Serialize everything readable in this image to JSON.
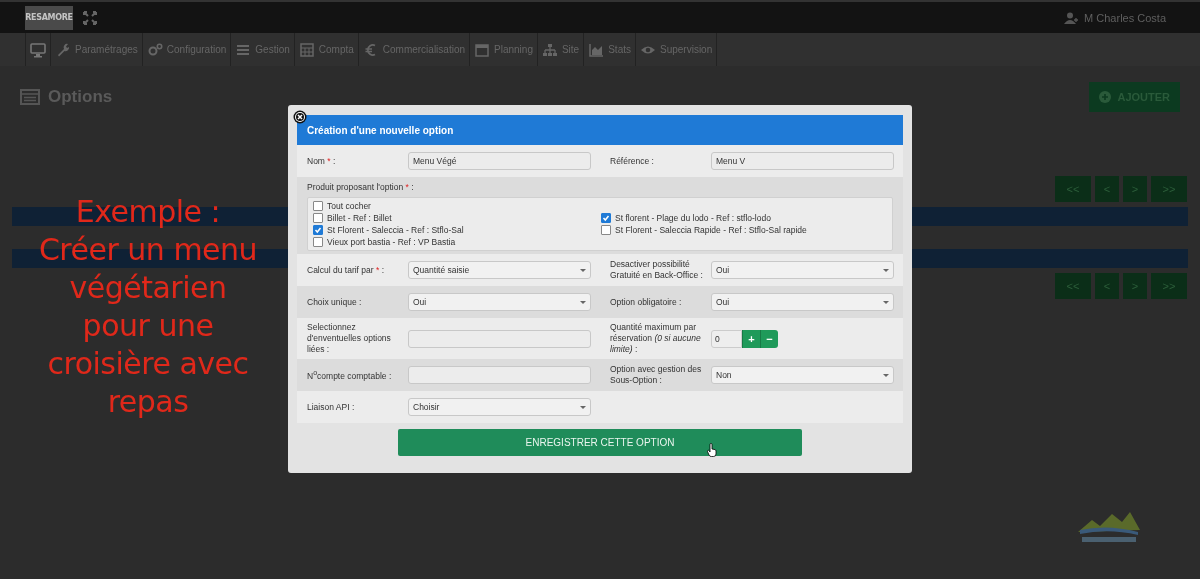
{
  "topbar": {
    "logo": "RESAMORE",
    "user": "M Charles Costa"
  },
  "nav": [
    {
      "kind": "home"
    },
    {
      "kind": "tab",
      "label": "Paramétrages"
    },
    {
      "kind": "tab",
      "label": "Configuration"
    },
    {
      "kind": "tab",
      "label": "Gestion"
    },
    {
      "kind": "tab",
      "label": "Compta"
    },
    {
      "kind": "tab",
      "label": "Commercialisation"
    },
    {
      "kind": "tab",
      "label": "Planning"
    },
    {
      "kind": "tab",
      "label": "Site"
    },
    {
      "kind": "tab",
      "label": "Stats"
    },
    {
      "kind": "tab",
      "label": "Supervision"
    }
  ],
  "page": {
    "title": "Options",
    "add_button": "AJOUTER",
    "pagers": [
      [
        "<<",
        "<",
        ">",
        ">>"
      ],
      [
        "<<",
        "<",
        ">",
        ">>"
      ]
    ]
  },
  "caption": {
    "lines": [
      "Exemple :",
      "Créer un menu",
      "végétarien",
      "pour une",
      "croisière avec",
      "repas"
    ]
  },
  "modal": {
    "title": "Création d'une nouvelle option",
    "products": {
      "label": "Produit proposant l'option ",
      "required_mark": "*",
      "label_end": " :",
      "left": [
        {
          "label": "Tout cocher",
          "checked": false
        },
        {
          "label": "Billet - Ref : Billet",
          "checked": false
        },
        {
          "label": "St Florent - Saleccia - Ref : Stflo-Sal",
          "checked": true
        },
        {
          "label": "Vieux port bastia - Ref : VP Bastia",
          "checked": false
        }
      ],
      "right": [
        {
          "label": "St florent - Plage du lodo - Ref : stflo-lodo",
          "checked": true
        },
        {
          "label": "St Florent - Saleccia Rapide - Ref : Stflo-Sal rapide",
          "checked": false
        }
      ]
    },
    "rows": [
      {
        "fields": [
          {
            "kind": "text",
            "label": "Nom ",
            "required_mark": "*",
            "label_end": " :",
            "value": "Menu Végé"
          },
          {
            "kind": "text",
            "label": "Référence :",
            "value": "Menu V"
          }
        ]
      },
      {
        "kind": "products"
      },
      {
        "fields": [
          {
            "kind": "select",
            "label": "Calcul du tarif par ",
            "required_mark": "*",
            "label_end": " :",
            "value": "Quantité saisie"
          },
          {
            "kind": "select",
            "label": "Desactiver possibilité Gratuité en Back-Office :",
            "value": "Oui"
          }
        ]
      },
      {
        "fields": [
          {
            "kind": "select",
            "label": "Choix unique :",
            "value": "Oui"
          },
          {
            "kind": "select",
            "label": "Option obligatoire :",
            "value": "Oui"
          }
        ]
      },
      {
        "fields": [
          {
            "kind": "text",
            "label": "Selectionnez d'enventuelles options liées :"
          },
          {
            "kind": "stepper",
            "label": "Quantité maximum par réservation *(0 si aucune limite)* :",
            "value": "0",
            "plus": "+",
            "minus": "−"
          }
        ]
      },
      {
        "fields": [
          {
            "kind": "text",
            "label": "N$^{o}$compte comptable :"
          },
          {
            "kind": "select",
            "label": "Option avec gestion des Sous-Option :",
            "value": "Non"
          }
        ]
      },
      {
        "fields": [
          {
            "kind": "select",
            "label": "Liaison API :",
            "value": "Choisir"
          }
        ]
      }
    ],
    "submit": "ENREGISTRER CETTE OPTION"
  }
}
